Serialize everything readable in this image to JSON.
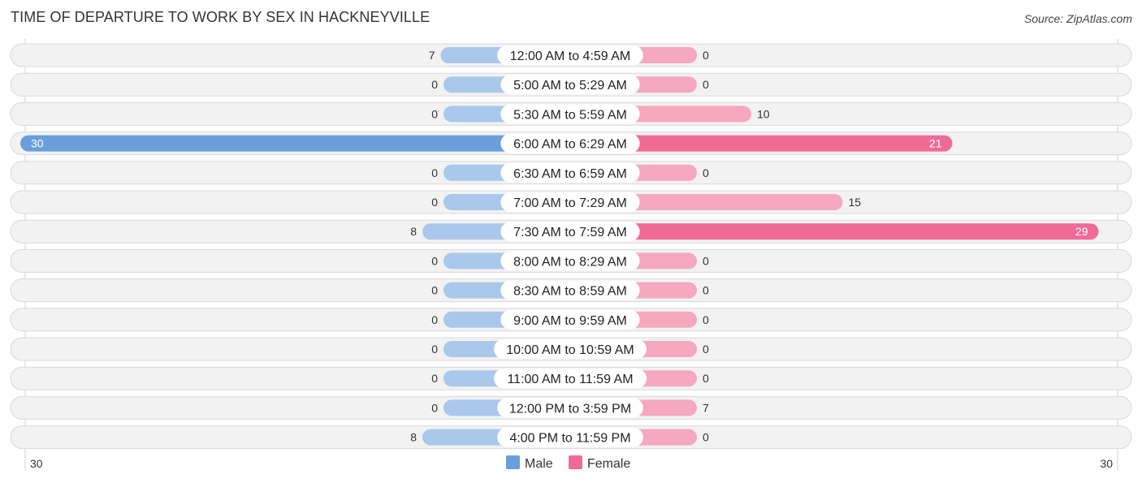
{
  "chart_data": {
    "type": "bar",
    "orientation": "horizontal-diverging",
    "title": "TIME OF DEPARTURE TO WORK BY SEX IN HACKNEYVILLE",
    "source": "Source: ZipAtlas.com",
    "categories": [
      "12:00 AM to 4:59 AM",
      "5:00 AM to 5:29 AM",
      "5:30 AM to 5:59 AM",
      "6:00 AM to 6:29 AM",
      "6:30 AM to 6:59 AM",
      "7:00 AM to 7:29 AM",
      "7:30 AM to 7:59 AM",
      "8:00 AM to 8:29 AM",
      "8:30 AM to 8:59 AM",
      "9:00 AM to 9:59 AM",
      "10:00 AM to 10:59 AM",
      "11:00 AM to 11:59 AM",
      "12:00 PM to 3:59 PM",
      "4:00 PM to 11:59 PM"
    ],
    "series": [
      {
        "name": "Male",
        "color": "#6a9fdc",
        "light_color": "#a9c8ec",
        "values": [
          7,
          0,
          0,
          30,
          0,
          0,
          8,
          0,
          0,
          0,
          0,
          0,
          0,
          8
        ]
      },
      {
        "name": "Female",
        "color": "#f06a96",
        "light_color": "#f5a8c0",
        "values": [
          0,
          0,
          10,
          21,
          0,
          15,
          29,
          0,
          0,
          0,
          0,
          0,
          7,
          0
        ]
      }
    ],
    "axis": {
      "left_tick": "30",
      "right_tick": "30",
      "range": [
        0,
        30
      ]
    },
    "legend": {
      "position": "bottom-center",
      "items": [
        "Male",
        "Female"
      ]
    }
  }
}
